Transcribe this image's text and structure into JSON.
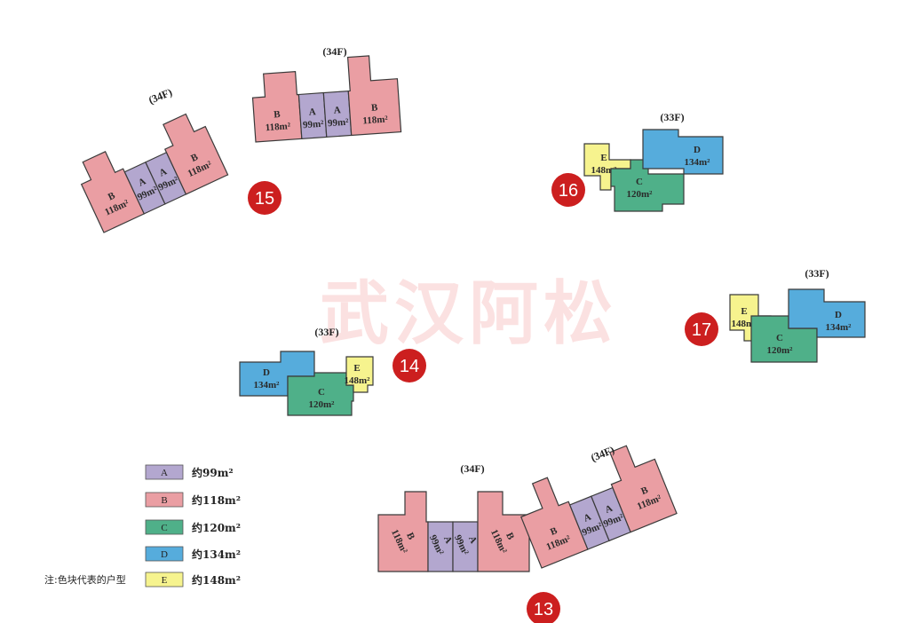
{
  "colors": {
    "A": "#b3a7cf",
    "B": "#ea9ea3",
    "C": "#4fb089",
    "D": "#56acdc",
    "E": "#f6f38e",
    "badge": "#cc1f1f"
  },
  "watermark": "武汉阿松",
  "buildings": {
    "b15": {
      "badge": "15",
      "left_floors": "(34F)",
      "right_floors": "(34F)",
      "units": [
        {
          "type": "B",
          "area": "118m²"
        },
        {
          "type": "A",
          "area": "99m²"
        },
        {
          "type": "A",
          "area": "99m²"
        },
        {
          "type": "B",
          "area": "118m²"
        },
        {
          "type": "B",
          "area": "118m²"
        },
        {
          "type": "A",
          "area": "99m²"
        },
        {
          "type": "A",
          "area": "99m²"
        },
        {
          "type": "B",
          "area": "118m²"
        }
      ]
    },
    "b16": {
      "badge": "16",
      "floors": "(33F)",
      "units": [
        {
          "type": "E",
          "area": "148m²"
        },
        {
          "type": "C",
          "area": "120m²"
        },
        {
          "type": "D",
          "area": "134m²"
        }
      ]
    },
    "b14": {
      "badge": "14",
      "floors": "(33F)",
      "units": [
        {
          "type": "D",
          "area": "134m²"
        },
        {
          "type": "C",
          "area": "120m²"
        },
        {
          "type": "E",
          "area": "148m²"
        }
      ]
    },
    "b17": {
      "badge": "17",
      "floors": "(33F)",
      "units": [
        {
          "type": "E",
          "area": "148m²"
        },
        {
          "type": "C",
          "area": "120m²"
        },
        {
          "type": "D",
          "area": "134m²"
        }
      ]
    },
    "b13": {
      "badge": "13",
      "left_floors": "(34F)",
      "right_floors": "(34F)",
      "units": [
        {
          "type": "B",
          "area": "118m²"
        },
        {
          "type": "A",
          "area": "99m²"
        },
        {
          "type": "A",
          "area": "99m²"
        },
        {
          "type": "B",
          "area": "118m²"
        },
        {
          "type": "B",
          "area": "118m²"
        },
        {
          "type": "A",
          "area": "99m²"
        },
        {
          "type": "A",
          "area": "99m²"
        },
        {
          "type": "B",
          "area": "118m²"
        }
      ]
    }
  },
  "legend": {
    "note": "注:色块代表的户型",
    "items": [
      {
        "swatch": "A",
        "label": "约99m²"
      },
      {
        "swatch": "B",
        "label": "约118m²"
      },
      {
        "swatch": "C",
        "label": "约120m²"
      },
      {
        "swatch": "D",
        "label": "约134m²"
      },
      {
        "swatch": "E",
        "label": "约148m²"
      }
    ]
  }
}
